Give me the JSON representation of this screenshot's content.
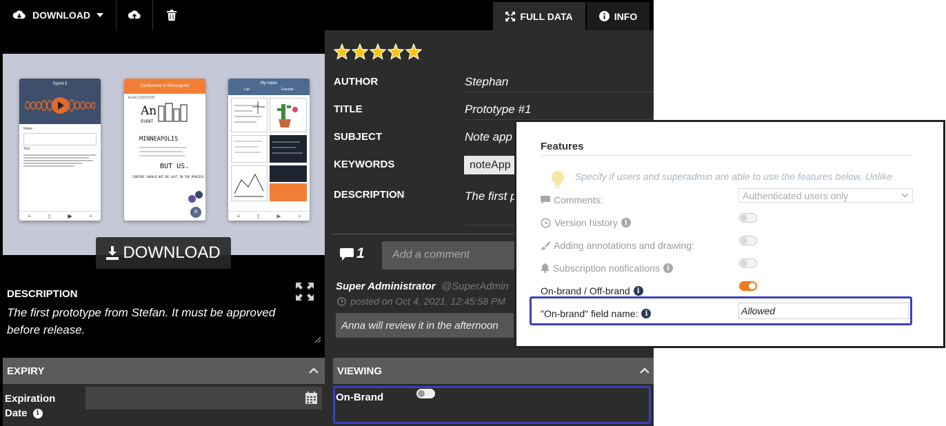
{
  "toolbar": {
    "download_label": "DOWNLOAD",
    "tabs": [
      {
        "label": "FULL DATA",
        "active": true
      },
      {
        "label": "INFO",
        "active": false
      }
    ]
  },
  "preview": {
    "download_overlay_label": "DOWNLOAD",
    "phones": [
      {
        "title": "Sprint 5",
        "notes_label": "Notes",
        "text_label": "Text"
      },
      {
        "title": "Conference in Minneapolis",
        "event_label": "Event 12/01/2021",
        "art_lines": [
          "MINNEAPOLIS",
          "BUT US.",
          "CONTENT SHOULD NOT BE LAST IN THE PROCESS."
        ]
      },
      {
        "title": "My notes",
        "tabs": [
          "List",
          "Favorite"
        ]
      }
    ]
  },
  "description_panel": {
    "heading": "DESCRIPTION",
    "text": "The first prototype from Stefan. It must be approved before release."
  },
  "expiry": {
    "header": "EXPIRY",
    "field_label_line1": "Expiration",
    "field_label_line2": "Date"
  },
  "metadata": {
    "rating": 5,
    "rating_max": 5,
    "fields": [
      {
        "label": "AUTHOR",
        "value": "Stephan"
      },
      {
        "label": "TITLE",
        "value": "Prototype #1"
      },
      {
        "label": "SUBJECT",
        "value": "Note app"
      },
      {
        "label": "KEYWORDS",
        "value": "noteApp"
      },
      {
        "label": "DESCRIPTION",
        "value": "The first p"
      }
    ]
  },
  "comments": {
    "count": "1",
    "placeholder": "Add a comment",
    "author": "Super Administrator",
    "handle": "@SuperAdmin",
    "posted": "posted on Oct 4, 2021, 12:45:58 PM",
    "text": "Anna will review it in the afternoon"
  },
  "viewing": {
    "header": "VIEWING",
    "onbrand_label": "On-Brand",
    "onbrand_enabled": false
  },
  "features": {
    "title": "Features",
    "hint": "Specify if users and superadmin are able to use the features below. Unlike",
    "comments_label": "Comments:",
    "comments_select_value": "Authenticated users only",
    "version_history_label": "Version history",
    "annotations_label": "Adding annotations and drawing:",
    "subscriptions_label": "Subscription notifications",
    "onoff_brand_label": "On-brand / Off-brand",
    "onoff_brand_enabled": true,
    "field_name_label": "\"On-brand\" field name:",
    "field_name_value": "Allowed"
  },
  "colors": {
    "accent_orange": "#f07a20",
    "highlight_blue": "#3b3fbf",
    "star_gold": "#f5c518"
  }
}
